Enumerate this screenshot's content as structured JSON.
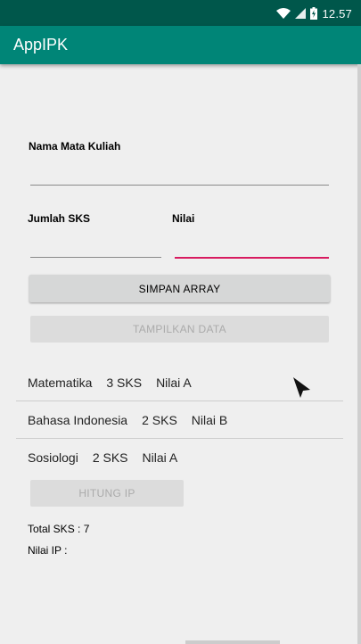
{
  "status": {
    "time": "12.57"
  },
  "app": {
    "title": "AppIPK"
  },
  "form": {
    "course_label": "Nama Mata Kuliah",
    "course_value": "",
    "sks_label": "Jumlah SKS",
    "sks_value": "",
    "grade_label": "Nilai",
    "grade_value": ""
  },
  "buttons": {
    "save_array": "SIMPAN ARRAY",
    "show_data": "TAMPILKAN DATA",
    "calc_ip": "HITUNG IP"
  },
  "list": [
    {
      "course": "Matematika",
      "sks": "3 SKS",
      "grade": "Nilai A"
    },
    {
      "course": "Bahasa Indonesia",
      "sks": "2 SKS",
      "grade": "Nilai B"
    },
    {
      "course": "Sosiologi",
      "sks": "2 SKS",
      "grade": "Nilai A"
    }
  ],
  "summary": {
    "total_sks": "Total SKS : 7",
    "ip": "Nilai IP :"
  },
  "colors": {
    "status_bar": "#00574b",
    "app_bar": "#008577",
    "accent": "#d81b60"
  },
  "icons": [
    "wifi-icon",
    "signal-icon",
    "battery-charging-icon",
    "mouse-cursor-icon"
  ]
}
